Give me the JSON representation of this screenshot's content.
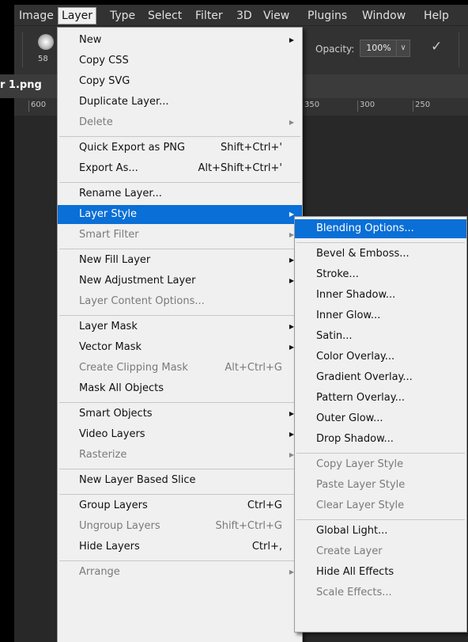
{
  "menubar": {
    "items": [
      "Image",
      "Layer",
      "Type",
      "Select",
      "Filter",
      "3D",
      "View",
      "Plugins",
      "Window",
      "Help"
    ],
    "active_index": 1
  },
  "options": {
    "brush_size": "58",
    "opacity_label": "Opacity:",
    "opacity_value": "100%"
  },
  "document": {
    "tab_label": "r 1.png"
  },
  "ruler": {
    "ticks": [
      "600",
      "350",
      "300",
      "250"
    ]
  },
  "layer_menu": {
    "items": [
      {
        "label": "New",
        "submenu": true
      },
      {
        "label": "Copy CSS"
      },
      {
        "label": "Copy SVG"
      },
      {
        "label": "Duplicate Layer..."
      },
      {
        "label": "Delete",
        "submenu": true,
        "disabled": true
      },
      {
        "separator": true
      },
      {
        "label": "Quick Export as PNG",
        "shortcut": "Shift+Ctrl+'"
      },
      {
        "label": "Export As...",
        "shortcut": "Alt+Shift+Ctrl+'"
      },
      {
        "separator": true
      },
      {
        "label": "Rename Layer..."
      },
      {
        "label": "Layer Style",
        "submenu": true,
        "highlighted": true
      },
      {
        "label": "Smart Filter",
        "submenu": true,
        "disabled": true
      },
      {
        "separator": true
      },
      {
        "label": "New Fill Layer",
        "submenu": true
      },
      {
        "label": "New Adjustment Layer",
        "submenu": true
      },
      {
        "label": "Layer Content Options...",
        "disabled": true
      },
      {
        "separator": true
      },
      {
        "label": "Layer Mask",
        "submenu": true
      },
      {
        "label": "Vector Mask",
        "submenu": true
      },
      {
        "label": "Create Clipping Mask",
        "shortcut": "Alt+Ctrl+G",
        "disabled": true
      },
      {
        "label": "Mask All Objects"
      },
      {
        "separator": true
      },
      {
        "label": "Smart Objects",
        "submenu": true
      },
      {
        "label": "Video Layers",
        "submenu": true
      },
      {
        "label": "Rasterize",
        "submenu": true,
        "disabled": true
      },
      {
        "separator": true
      },
      {
        "label": "New Layer Based Slice"
      },
      {
        "separator": true
      },
      {
        "label": "Group Layers",
        "shortcut": "Ctrl+G"
      },
      {
        "label": "Ungroup Layers",
        "shortcut": "Shift+Ctrl+G",
        "disabled": true
      },
      {
        "label": "Hide Layers",
        "shortcut": "Ctrl+,"
      },
      {
        "separator": true
      },
      {
        "label": "Arrange",
        "submenu": true,
        "disabled": true
      }
    ]
  },
  "layer_style_menu": {
    "items": [
      {
        "label": "Blending Options...",
        "highlighted": true
      },
      {
        "separator": true
      },
      {
        "label": "Bevel & Emboss..."
      },
      {
        "label": "Stroke..."
      },
      {
        "label": "Inner Shadow..."
      },
      {
        "label": "Inner Glow..."
      },
      {
        "label": "Satin..."
      },
      {
        "label": "Color Overlay..."
      },
      {
        "label": "Gradient Overlay..."
      },
      {
        "label": "Pattern Overlay..."
      },
      {
        "label": "Outer Glow..."
      },
      {
        "label": "Drop Shadow..."
      },
      {
        "separator": true
      },
      {
        "label": "Copy Layer Style",
        "disabled": true
      },
      {
        "label": "Paste Layer Style",
        "disabled": true
      },
      {
        "label": "Clear Layer Style",
        "disabled": true
      },
      {
        "separator": true
      },
      {
        "label": "Global Light..."
      },
      {
        "label": "Create Layer",
        "disabled": true
      },
      {
        "label": "Hide All Effects"
      },
      {
        "label": "Scale Effects...",
        "disabled": true
      }
    ]
  },
  "colors": {
    "menu_bg": "#f0f0f0",
    "highlight": "#0a6fd6",
    "chrome": "#323232",
    "canvas": "#282828"
  }
}
